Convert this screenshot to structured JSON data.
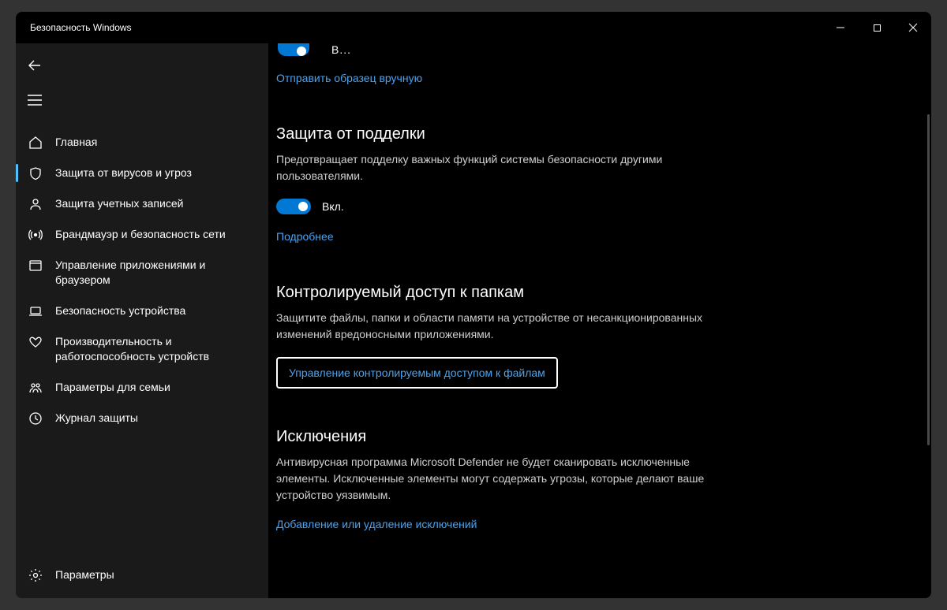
{
  "titlebar": {
    "title": "Безопасность Windows"
  },
  "sidebar": {
    "items": [
      {
        "id": "home",
        "label": "Главная"
      },
      {
        "id": "virus",
        "label": "Защита от вирусов и угроз"
      },
      {
        "id": "account",
        "label": "Защита учетных записей"
      },
      {
        "id": "firewall",
        "label": "Брандмауэр и безопасность сети"
      },
      {
        "id": "appbrowser",
        "label": "Управление приложениями и браузером"
      },
      {
        "id": "device",
        "label": "Безопасность устройства"
      },
      {
        "id": "perf",
        "label": "Производительность и работоспособность устройств"
      },
      {
        "id": "family",
        "label": "Параметры для семьи"
      },
      {
        "id": "history",
        "label": "Журнал защиты"
      }
    ],
    "bottom": {
      "label": "Параметры"
    }
  },
  "content": {
    "cutoff_status": "В...",
    "submit_link": "Отправить образец вручную",
    "tamper": {
      "title": "Защита от подделки",
      "desc": "Предотвращает подделку важных функций системы безопасности другими пользователями.",
      "toggle_label": "Вкл.",
      "more_link": "Подробнее"
    },
    "cfa": {
      "title": "Контролируемый доступ к папкам",
      "desc": "Защитите файлы, папки и области памяти на устройстве от несанкционированных изменений вредоносными приложениями.",
      "manage_link": "Управление контролируемым доступом к файлам"
    },
    "exclusions": {
      "title": "Исключения",
      "desc": "Антивирусная программа Microsoft Defender не будет сканировать исключенные элементы. Исключенные элементы могут содержать угрозы, которые делают ваше устройство уязвимым.",
      "add_link": "Добавление или удаление исключений"
    }
  }
}
